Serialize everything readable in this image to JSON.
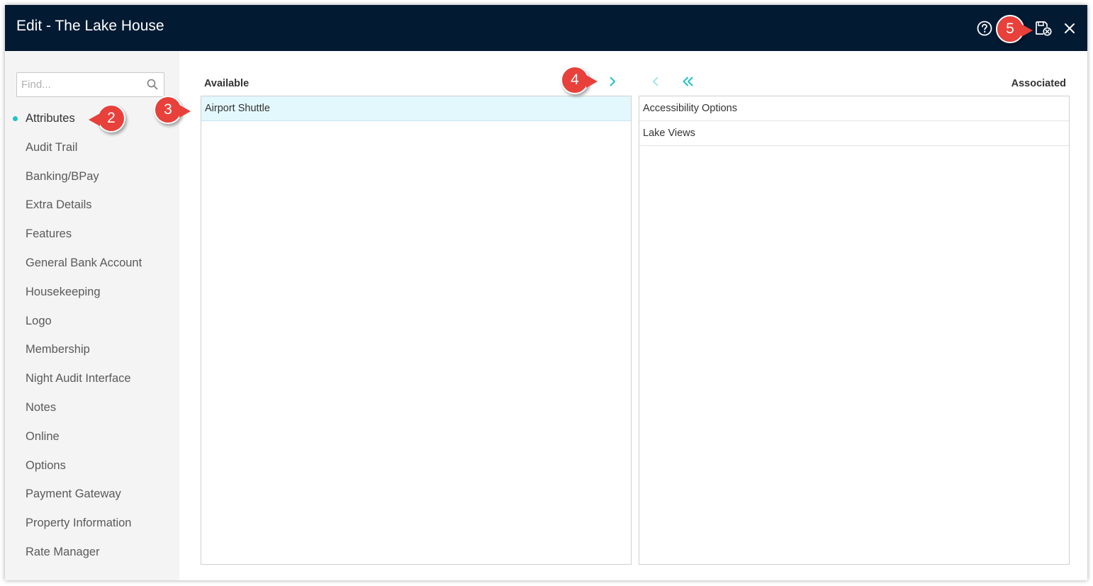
{
  "window": {
    "title": "Edit - The Lake House"
  },
  "toolbar": {
    "help_icon": "help-circle-icon",
    "save_icon": "save-close-icon",
    "close_icon": "close-icon"
  },
  "sidebar": {
    "search_placeholder": "Find...",
    "items": [
      {
        "label": "Attributes",
        "active": true
      },
      {
        "label": "Audit Trail"
      },
      {
        "label": "Banking/BPay"
      },
      {
        "label": "Extra Details"
      },
      {
        "label": "Features"
      },
      {
        "label": "General Bank Account"
      },
      {
        "label": "Housekeeping"
      },
      {
        "label": "Logo"
      },
      {
        "label": "Membership"
      },
      {
        "label": "Night Audit Interface"
      },
      {
        "label": "Notes"
      },
      {
        "label": "Online"
      },
      {
        "label": "Options"
      },
      {
        "label": "Payment Gateway"
      },
      {
        "label": "Property Information"
      },
      {
        "label": "Rate Manager"
      }
    ]
  },
  "available": {
    "header": "Available",
    "items": [
      "Airport Shuttle"
    ],
    "selected_index": 0
  },
  "associated": {
    "header": "Associated",
    "items": [
      "Accessibility Options",
      "Lake Views"
    ]
  },
  "annotations": [
    "2",
    "3",
    "4",
    "5"
  ],
  "colors": {
    "titlebar": "#031a33",
    "accent": "#1ec3c8",
    "selected_row": "#e3f8fc",
    "callout": "#e8403a",
    "sidebar_bg": "#f4f4f4"
  }
}
